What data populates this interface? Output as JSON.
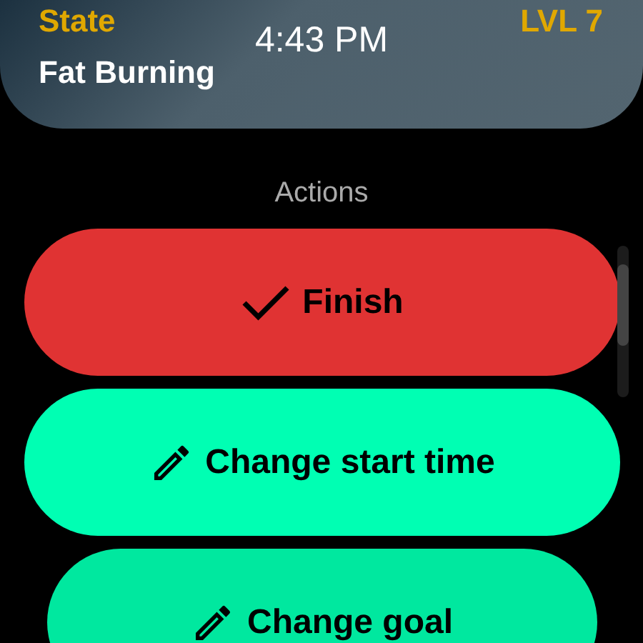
{
  "status_bar": {
    "time": "4:43 PM"
  },
  "header": {
    "label": "State",
    "value": "Fat Burning",
    "level": "LVL 7"
  },
  "section_title": "Actions",
  "actions": [
    {
      "label": "Finish",
      "kind": "check",
      "color": "#e03333"
    },
    {
      "label": "Change start time",
      "kind": "edit",
      "color": "#00ffb3"
    },
    {
      "label": "Change goal",
      "kind": "edit",
      "color": "#00e89f"
    }
  ]
}
